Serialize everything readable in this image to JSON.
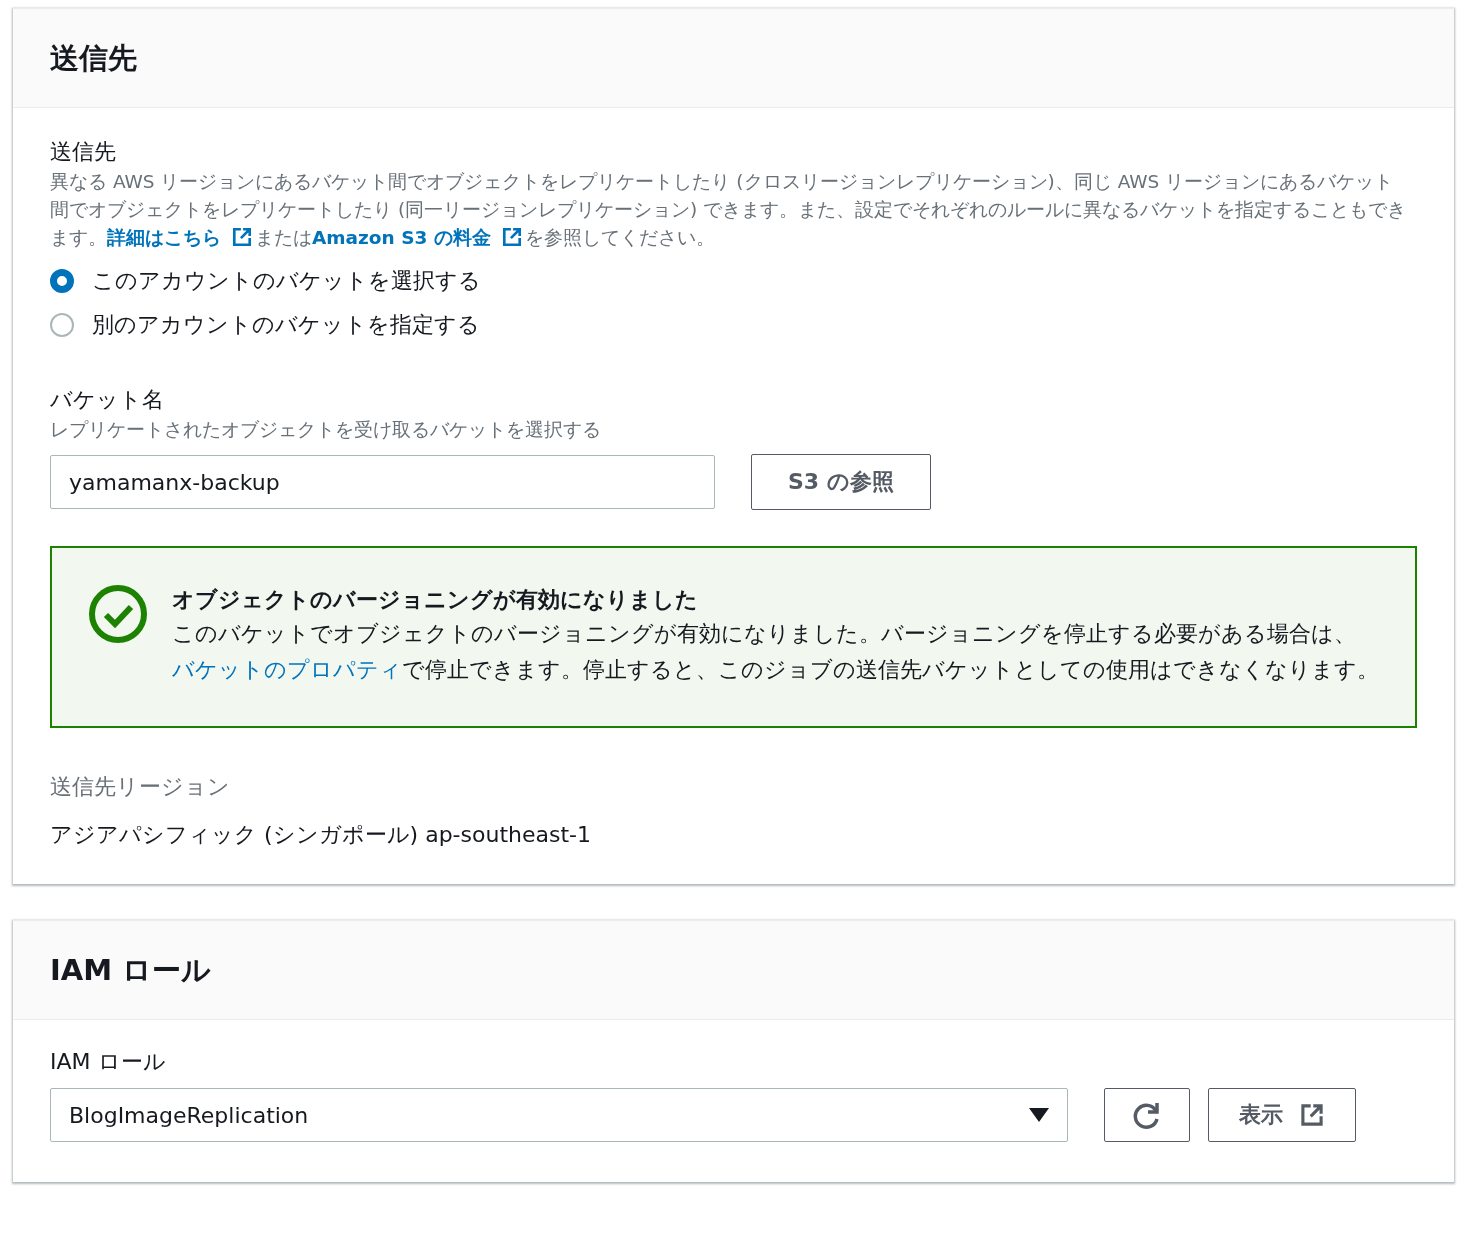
{
  "destination": {
    "title": "送信先",
    "field_label": "送信先",
    "description": [
      {
        "kind": "text",
        "text": "異なる AWS リージョンにあるバケット間でオブジェクトをレプリケートしたり (クロスリージョンレプリケーション)、同じ AWS リージョンにあるバケット間でオブジェクトをレプリケートしたり (同一リージョンレプリケーション) できます。また、設定でそれぞれのルールに異なるバケットを指定することもできます。"
      },
      {
        "kind": "external_link",
        "text": "詳細はこちら"
      },
      {
        "kind": "text",
        "text": "または"
      },
      {
        "kind": "external_link",
        "text": "Amazon S3 の料金"
      },
      {
        "kind": "text",
        "text": "を参照してください。"
      }
    ],
    "options": [
      {
        "label": "このアカウントのバケットを選択する",
        "selected": true
      },
      {
        "label": "別のアカウントのバケットを指定する",
        "selected": false
      }
    ],
    "bucket": {
      "label": "バケット名",
      "description": "レプリケートされたオブジェクトを受け取るバケットを選択する",
      "value": "yamamanx-backup",
      "browse_button": "S3 の参照"
    },
    "alert": {
      "title": "オブジェクトのバージョニングが有効になりました",
      "body": [
        {
          "kind": "text",
          "text": "このバケットでオブジェクトのバージョニングが有効になりました。バージョニングを停止する必要がある場合は、"
        },
        {
          "kind": "link",
          "text": "バケットのプロパティ"
        },
        {
          "kind": "text",
          "text": "で停止できます。停止すると、このジョブの送信先バケットとしての使用はできなくなります。"
        }
      ]
    },
    "region": {
      "label": "送信先リージョン",
      "value": "アジアパシフィック (シンガポール) ap-southeast-1"
    }
  },
  "iam": {
    "title": "IAM ロール",
    "field_label": "IAM ロール",
    "select_value": "BlogImageReplication",
    "view_button": "表示"
  }
}
